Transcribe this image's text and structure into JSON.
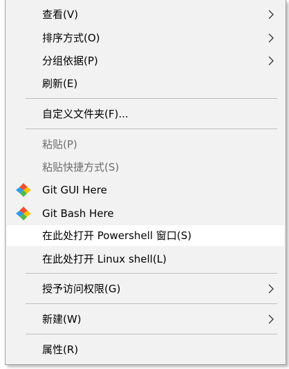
{
  "menu": {
    "items": [
      {
        "label": "查看(V)",
        "submenu": true
      },
      {
        "label": "排序方式(O)",
        "submenu": true
      },
      {
        "label": "分组依据(P)",
        "submenu": true
      },
      {
        "label": "刷新(E)",
        "submenu": false
      },
      {
        "label": "自定义文件夹(F)...",
        "submenu": false
      },
      {
        "label": "粘贴(P)",
        "disabled": true
      },
      {
        "label": "粘贴快捷方式(S)",
        "disabled": true
      },
      {
        "label": "Git GUI Here",
        "icon": "git-icon"
      },
      {
        "label": "Git Bash Here",
        "icon": "git-icon"
      },
      {
        "label": "在此处打开 Powershell 窗口(S)",
        "highlighted": true
      },
      {
        "label": "在此处打开 Linux shell(L)"
      },
      {
        "label": "授予访问权限(G)",
        "submenu": true
      },
      {
        "label": "新建(W)",
        "submenu": true
      },
      {
        "label": "属性(R)",
        "submenu": false
      }
    ]
  },
  "colors": {
    "menu_bg": "#f2f2f2",
    "highlight_bg": "#ffffff",
    "disabled_text": "#6d6d6d",
    "git_orange": "#f05133",
    "git_yellow": "#f5c400",
    "git_blue": "#2e9be6",
    "git_green": "#53b84a"
  }
}
